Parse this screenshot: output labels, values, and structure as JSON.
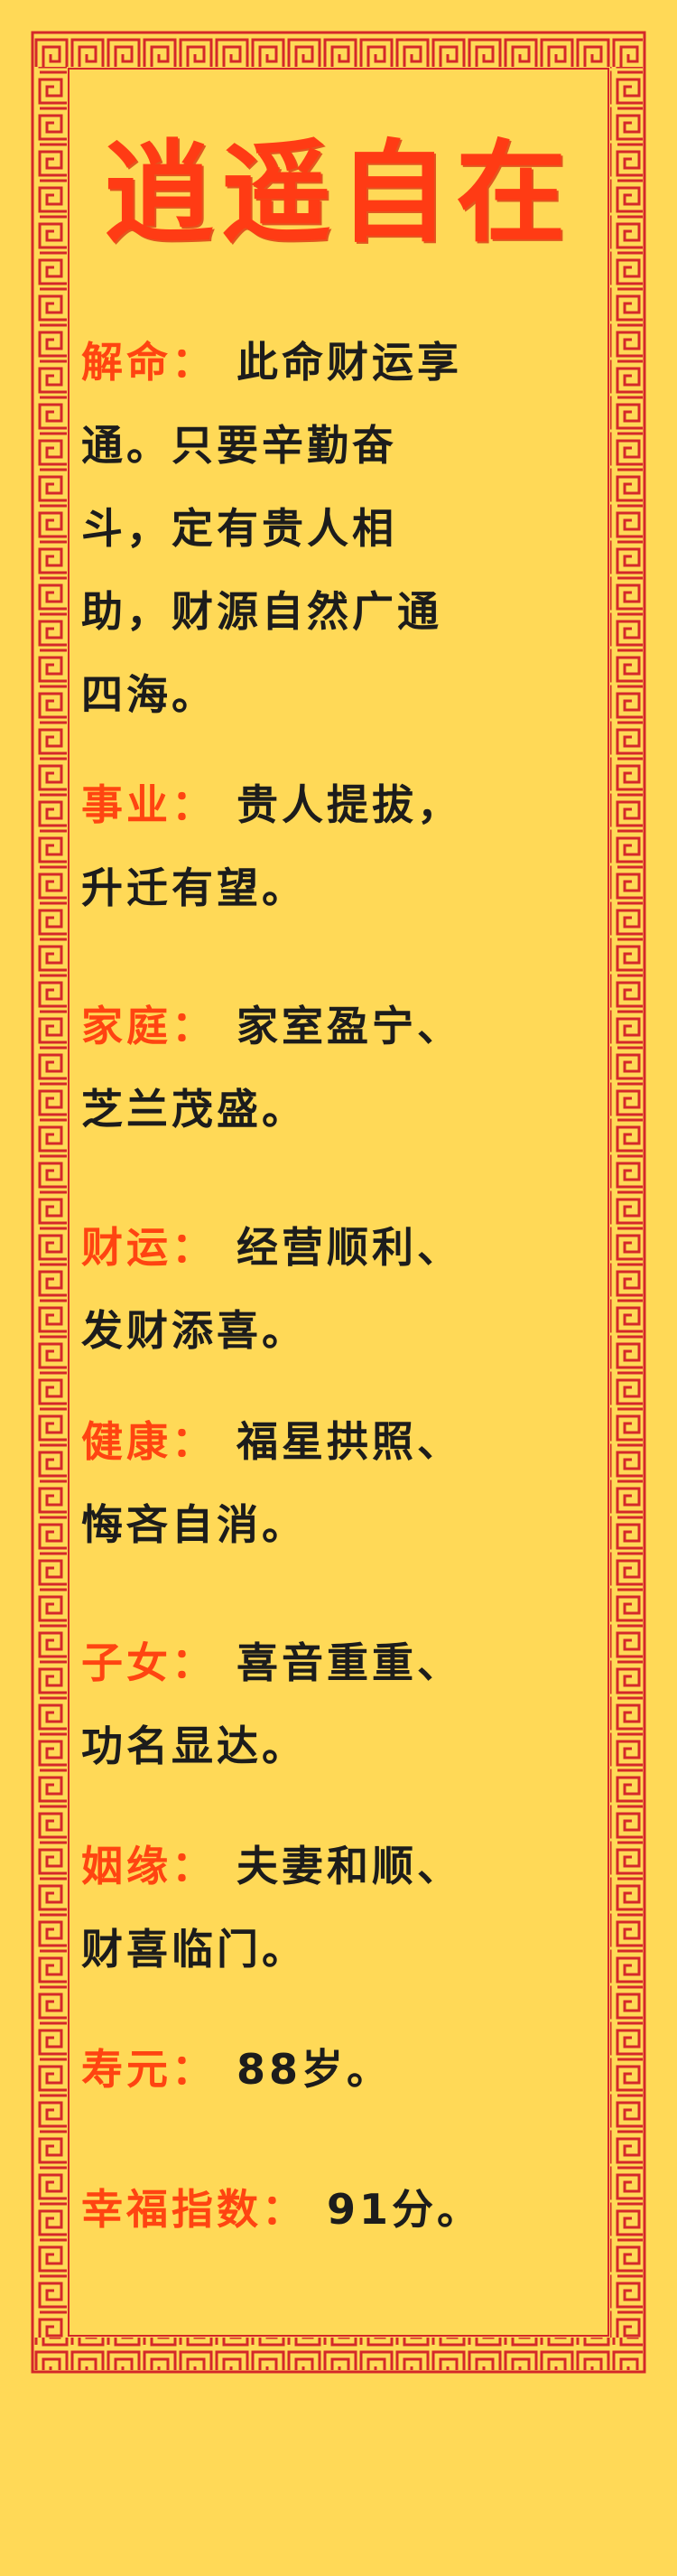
{
  "title": "逍遥自在",
  "colors": {
    "background": "#ffd957",
    "title": "#ff3b14",
    "label": "#ff4411",
    "text": "#1c1c1c",
    "border": "#d4282a"
  },
  "frame_icon": "chinese-fret-border",
  "sections": [
    {
      "label": "解命",
      "colon": "：",
      "lines": [
        "此命财运享",
        "通。只要辛勤奋",
        "斗，定有贵人相",
        "助，财源自然广通",
        "四海。"
      ]
    },
    {
      "label": "事业",
      "colon": "：",
      "lines": [
        "贵人提拔，",
        "升迁有望。"
      ]
    },
    {
      "label": "家庭",
      "colon": "：",
      "lines": [
        "家室盈宁、",
        "芝兰茂盛。"
      ]
    },
    {
      "label": "财运",
      "colon": "：",
      "lines": [
        "经营顺利、",
        "发财添喜。"
      ]
    },
    {
      "label": "健康",
      "colon": "：",
      "lines": [
        "福星拱照、",
        "悔吝自消。"
      ]
    },
    {
      "label": "子女",
      "colon": "：",
      "lines": [
        "喜音重重、",
        "功名显达。"
      ]
    },
    {
      "label": "姻缘",
      "colon": "：",
      "lines": [
        "夫妻和顺、",
        "财喜临门。"
      ]
    },
    {
      "label": "寿元",
      "colon": "：",
      "lines": [
        "88岁。"
      ]
    },
    {
      "label": "幸福指数",
      "colon": "：",
      "lines": [
        "91分。"
      ]
    }
  ]
}
